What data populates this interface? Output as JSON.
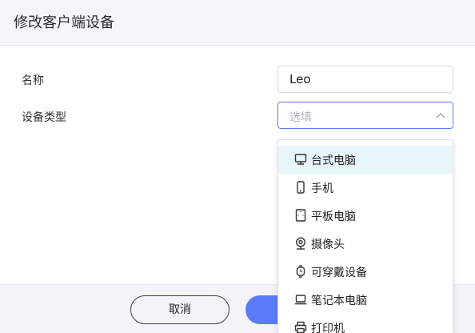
{
  "dialog": {
    "title": "修改客户端设备"
  },
  "form": {
    "name_label": "名称",
    "name_value": "Leo",
    "type_label": "设备类型",
    "type_placeholder": "选填"
  },
  "footer": {
    "cancel_label": "取消"
  },
  "dropdown": {
    "options": [
      {
        "label": "台式电脑",
        "icon": "desktop-icon",
        "active": true
      },
      {
        "label": "手机",
        "icon": "phone-icon",
        "active": false
      },
      {
        "label": "平板电脑",
        "icon": "tablet-icon",
        "active": false
      },
      {
        "label": "摄像头",
        "icon": "camera-icon",
        "active": false
      },
      {
        "label": "可穿戴设备",
        "icon": "smartwatch-icon",
        "active": false
      },
      {
        "label": "笔记本电脑",
        "icon": "laptop-icon",
        "active": false
      },
      {
        "label": "打印机",
        "icon": "printer-icon",
        "active": false
      }
    ]
  },
  "colors": {
    "accent": "#5b7cfa",
    "active_option_bg": "#e7f6fb",
    "header_bg": "#f6f6f9"
  }
}
